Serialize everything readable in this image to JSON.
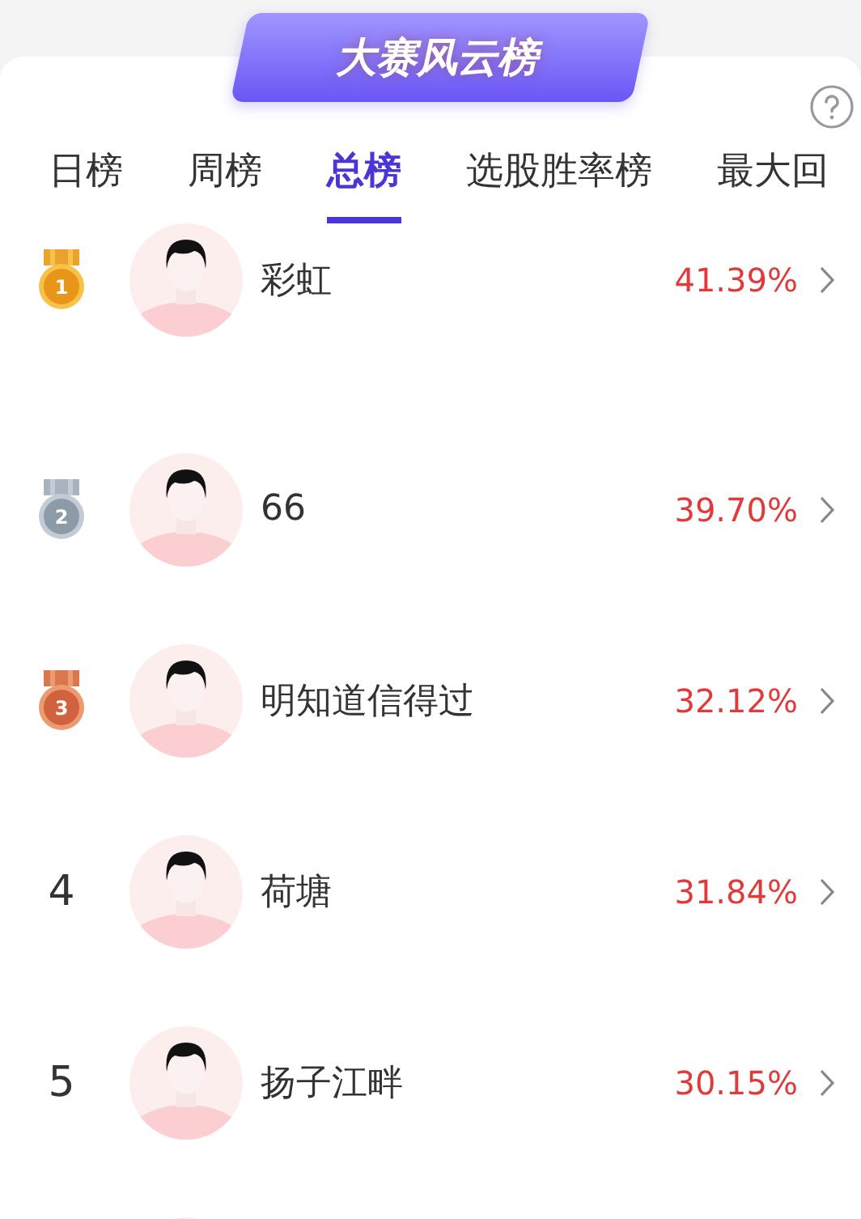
{
  "banner": {
    "title": "大赛风云榜"
  },
  "tabs": [
    {
      "label": "日榜",
      "selected": false
    },
    {
      "label": "周榜",
      "selected": false
    },
    {
      "label": "总榜",
      "selected": true
    },
    {
      "label": "选股胜率榜",
      "selected": false
    },
    {
      "label": "最大回",
      "selected": false
    }
  ],
  "rows": [
    {
      "kind": "gold",
      "rank": "1",
      "name": "彩虹",
      "rate": "41.39%"
    },
    {
      "kind": "silver",
      "rank": "2",
      "name": "66",
      "rate": "39.70%"
    },
    {
      "kind": "bronze",
      "rank": "3",
      "name": "明知道信得过",
      "rate": "32.12%"
    },
    {
      "kind": "plain",
      "rank": "4",
      "name": "荷塘",
      "rate": "31.84%"
    },
    {
      "kind": "plain",
      "rank": "5",
      "name": "扬子江畔",
      "rate": "30.15%"
    }
  ]
}
